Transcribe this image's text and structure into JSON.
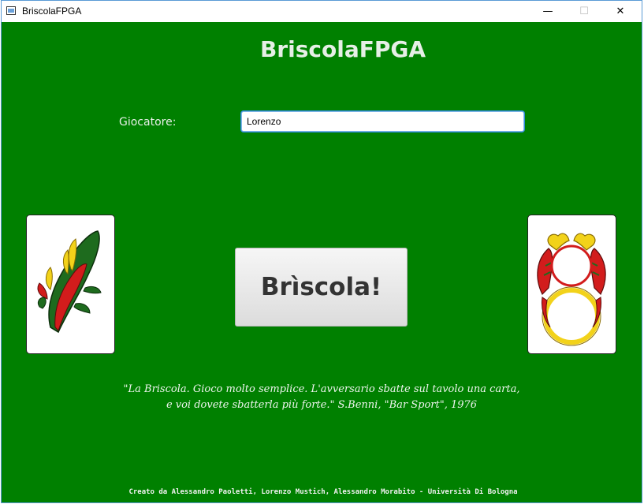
{
  "window": {
    "title": "BriscolaFPGA",
    "minimize_glyph": "—",
    "maximize_glyph": "☐",
    "close_glyph": "✕"
  },
  "main": {
    "heading": "BriscolaFPGA",
    "player_label": "Giocatore:",
    "player_value": "Lorenzo",
    "play_button": "Brìscola!",
    "quote_line1": "\"La Briscola. Gioco molto semplice. L'avversario sbatte sul tavolo una carta,",
    "quote_line2": "e voi dovete sbatterla più forte.\"  S.Benni, \"Bar Sport\", 1976",
    "footer": "Creato da Alessandro Paoletti, Lorenzo Mustich, Alessandro Morabito - Università Di Bologna"
  },
  "cards": {
    "left": "ace-of-clubs-card",
    "right": "ace-of-coins-card"
  },
  "colors": {
    "table_green": "#008000",
    "card_red": "#d21c1c",
    "card_green": "#1e6b1e",
    "card_yellow": "#f2d21a"
  }
}
